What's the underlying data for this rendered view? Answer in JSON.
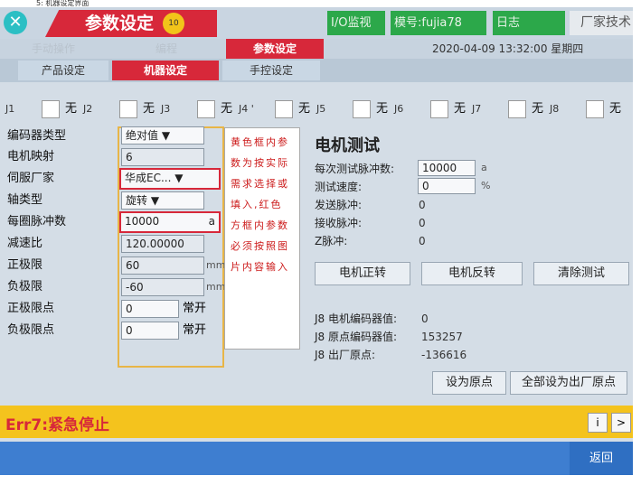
{
  "top_caption": "5: 机器设定界面",
  "titlebar": {
    "title": "参数设定",
    "badge": "10",
    "io_monitor": "I/O监视",
    "model": "模号:fujia78",
    "log": "日志",
    "factory_tech": "厂家技术员"
  },
  "row2": {
    "manual_op": "手动操作",
    "program": "编程",
    "param_setting": "参数设定",
    "datetime": "2020-04-09  13:32:00 星期四"
  },
  "tabs": [
    {
      "label": "产品设定"
    },
    {
      "label": "机器设定"
    },
    {
      "label": "手控设定"
    }
  ],
  "axis_toggles": {
    "none_label": "无",
    "axes": [
      "J1",
      "J2",
      "J3",
      "J4 '",
      "J5",
      "J6",
      "J7",
      "J8"
    ]
  },
  "params": {
    "encoder_type": {
      "label": "编码器类型",
      "value": "绝对值"
    },
    "motor_map": {
      "label": "电机映射",
      "value": "6"
    },
    "servo_vendor": {
      "label": "伺服厂家",
      "value": "华成EC..."
    },
    "axis_type": {
      "label": "轴类型",
      "value": "旋转"
    },
    "pulses_per_rev": {
      "label": "每圈脉冲数",
      "value": "10000",
      "unit": "a"
    },
    "reduction_ratio": {
      "label": "减速比",
      "value": "120.00000"
    },
    "pos_limit": {
      "label": "正极限",
      "value": "60",
      "unit": "mm"
    },
    "neg_limit": {
      "label": "负极限",
      "value": "-60",
      "unit": "mm"
    },
    "pos_limit_point": {
      "label": "正极限点",
      "value": "0",
      "state": "常开"
    },
    "neg_limit_point": {
      "label": "负极限点",
      "value": "0",
      "state": "常开"
    }
  },
  "note": "黄色框内参数为按实际需求选择或填入,红色方框内参数必须按照图片内容输入",
  "motor_test": {
    "title": "电机测试",
    "pulses_label": "每次测试脉冲数:",
    "pulses_value": "10000",
    "pulses_unit": "a",
    "speed_label": "测试速度:",
    "speed_value": "0",
    "speed_unit": "%",
    "sent_label": "发送脉冲:",
    "sent_value": "0",
    "recv_label": "接收脉冲:",
    "recv_value": "0",
    "z_label": "Z脉冲:",
    "z_value": "0",
    "forward": "电机正转",
    "reverse": "电机反转",
    "clear": "清除测试"
  },
  "encoder_info": {
    "motor_enc_label": "J8 电机编码器值:",
    "motor_enc_value": "0",
    "origin_enc_label": "J8 原点编码器值:",
    "origin_enc_value": "153257",
    "factory_origin_label": "J8 出厂原点:",
    "factory_origin_value": "-136616",
    "set_origin": "设为原点",
    "set_all_factory": "全部设为出厂原点"
  },
  "alarm": {
    "text": "Err7:紧急停止",
    "info_btn": "i",
    "next_btn": ">"
  },
  "bottom": {
    "back": "返回"
  },
  "colors": {
    "accent_red": "#d7283a",
    "alarm_yellow": "#f4c31d",
    "nav_blue": "#3e7ed0"
  }
}
